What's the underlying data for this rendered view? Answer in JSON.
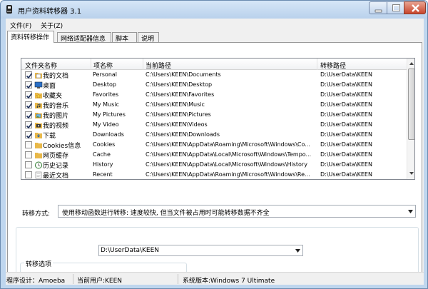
{
  "window": {
    "title": "用户资料转移器 3.1"
  },
  "menu": {
    "file": "文件(F)",
    "about": "关于(Z)"
  },
  "tabs": [
    "资料转移操作",
    "网络适配器信息",
    "脚本",
    "说明"
  ],
  "list": {
    "columns": [
      "文件夹名称",
      "项名称",
      "当前路径",
      "转移路径"
    ],
    "rows": [
      {
        "checked": true,
        "icon": "documents-folder-icon",
        "name": "我的文档",
        "item": "Personal",
        "current": "C:\\Users\\KEEN\\Documents",
        "target": "D:\\UserData\\KEEN"
      },
      {
        "checked": true,
        "icon": "desktop-icon",
        "name": "桌面",
        "item": "Desktop",
        "current": "C:\\Users\\KEEN\\Desktop",
        "target": "D:\\UserData\\KEEN"
      },
      {
        "checked": true,
        "icon": "favorites-star-icon",
        "name": "收藏夹",
        "item": "Favorites",
        "current": "C:\\Users\\KEEN\\Favorites",
        "target": "D:\\UserData\\KEEN"
      },
      {
        "checked": true,
        "icon": "music-folder-icon",
        "name": "我的音乐",
        "item": "My Music",
        "current": "C:\\Users\\KEEN\\Music",
        "target": "D:\\UserData\\KEEN"
      },
      {
        "checked": true,
        "icon": "pictures-folder-icon",
        "name": "我的图片",
        "item": "My Pictures",
        "current": "C:\\Users\\KEEN\\Pictures",
        "target": "D:\\UserData\\KEEN"
      },
      {
        "checked": true,
        "icon": "video-folder-icon",
        "name": "我的视频",
        "item": "My Video",
        "current": "C:\\Users\\KEEN\\Videos",
        "target": "D:\\UserData\\KEEN"
      },
      {
        "checked": true,
        "icon": "downloads-icon",
        "name": "下载",
        "item": "Downloads",
        "current": "C:\\Users\\KEEN\\Downloads",
        "target": "D:\\UserData\\KEEN"
      },
      {
        "checked": false,
        "icon": "cookies-folder-icon",
        "name": "Cookies信息",
        "item": "Cookies",
        "current": "C:\\Users\\KEEN\\AppData\\Roaming\\Microsoft\\Windows\\Co...",
        "target": "D:\\UserData\\KEEN"
      },
      {
        "checked": false,
        "icon": "cache-folder-icon",
        "name": "网页缓存",
        "item": "Cache",
        "current": "C:\\Users\\KEEN\\AppData\\Local\\Microsoft\\Windows\\Tempo...",
        "target": "D:\\UserData\\KEEN"
      },
      {
        "checked": false,
        "icon": "history-icon",
        "name": "历史记录",
        "item": "History",
        "current": "C:\\Users\\KEEN\\AppData\\Local\\Microsoft\\Windows\\History",
        "target": "D:\\UserData\\KEEN"
      },
      {
        "checked": false,
        "icon": "recent-docs-icon",
        "name": "最近文档",
        "item": "Recent",
        "current": "C:\\Users\\KEEN\\AppData\\Roaming\\Microsoft\\Windows\\Re...",
        "target": "D:\\UserData\\KEEN"
      }
    ]
  },
  "transfer": {
    "mode_label": "转移方式:",
    "mode_value": "使用移动函数进行转移: 速度较快, 但当文件被占用时可能转移数据不齐全"
  },
  "target_path": "D:\\UserData\\KEEN",
  "options_label": "转移选项",
  "status": {
    "designer": "程序设计：Amoeba",
    "user": "当前用户:KEEN",
    "os": "系统版本:Windows 7 Ultimate"
  },
  "colors": {
    "title_bar": "#bfd6ee",
    "close_button": "#c8452c",
    "folder": "#e8b84a"
  }
}
